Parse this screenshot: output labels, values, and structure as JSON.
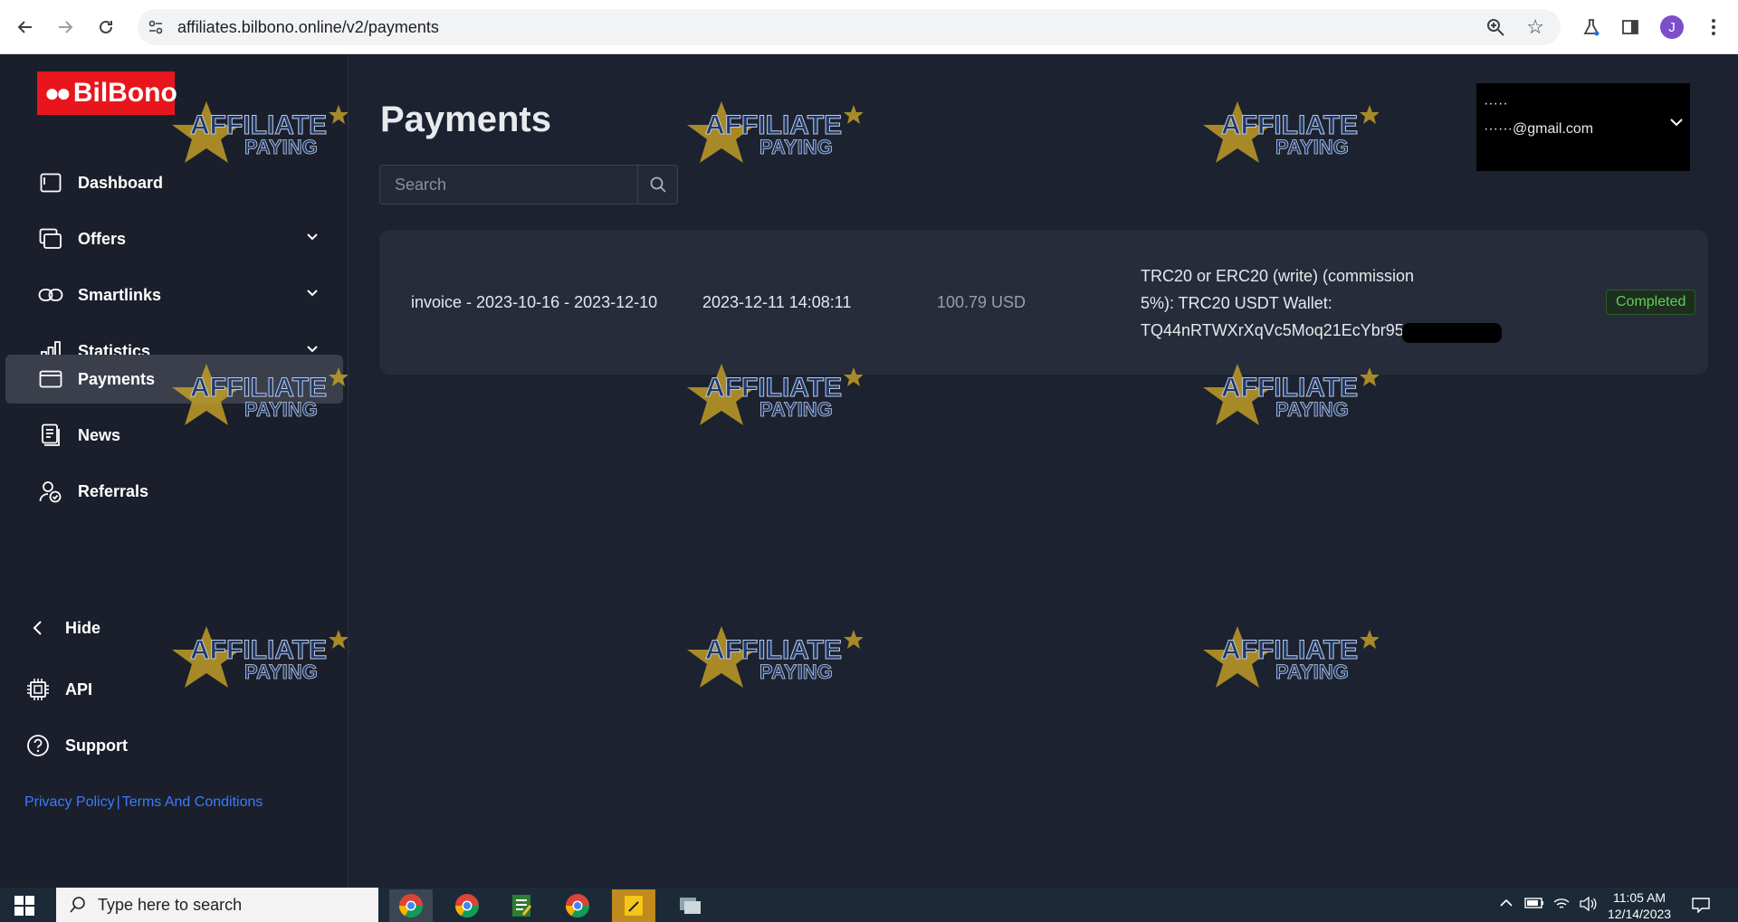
{
  "browser": {
    "url": "affiliates.bilbono.online/v2/payments",
    "profile_initial": "J"
  },
  "sidebar": {
    "logo_text": "BilBono",
    "items": [
      {
        "label": "Dashboard",
        "icon": "dashboard-icon"
      },
      {
        "label": "Offers",
        "icon": "offers-icon"
      },
      {
        "label": "Smartlinks",
        "icon": "smartlinks-icon"
      },
      {
        "label": "Statistics",
        "icon": "statistics-icon"
      },
      {
        "label": "Payments",
        "icon": "payments-icon"
      },
      {
        "label": "News",
        "icon": "news-icon"
      },
      {
        "label": "Referrals",
        "icon": "referrals-icon"
      }
    ],
    "hide_label": "Hide",
    "api_label": "API",
    "support_label": "Support",
    "privacy_label": "Privacy Policy",
    "terms_label": "Terms And Conditions"
  },
  "main": {
    "title": "Payments",
    "search_placeholder": "Search",
    "user": {
      "name": "·····",
      "email": "······@gmail.com"
    },
    "payments": [
      {
        "period": "invoice - 2023-10-16 - 2023-12-10",
        "date": "2023-12-11 14:08:11",
        "amount": "100.79 USD",
        "method_line1": "TRC20 or ERC20 (write) (commission",
        "method_line2": "5%): TRC20 USDT Wallet:",
        "method_line3": "TQ44nRTWXrXqVc5Moq21EcYbr95",
        "status": "Completed"
      }
    ]
  },
  "watermark": {
    "line1": "AFFILIATE",
    "line2": "PAYING"
  },
  "taskbar": {
    "search_placeholder": "Type here to search",
    "time": "11:05 AM",
    "date": "12/14/2023"
  },
  "colors": {
    "brand": "#e8161c",
    "background": "#1c2230",
    "status_completed": "#5fcf57",
    "link": "#3b7bff"
  }
}
